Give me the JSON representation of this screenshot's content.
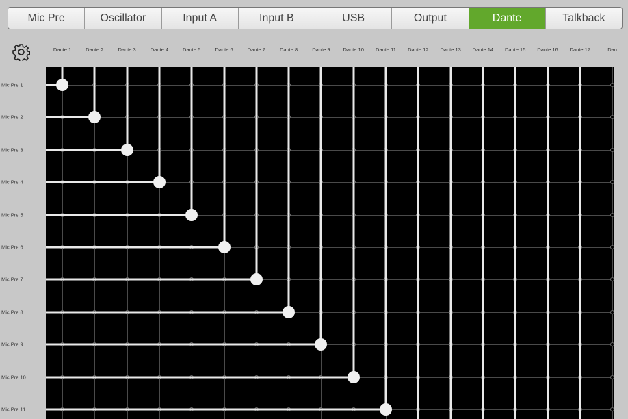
{
  "tabs": [
    {
      "label": "Mic Pre"
    },
    {
      "label": "Oscillator"
    },
    {
      "label": "Input A"
    },
    {
      "label": "Input B"
    },
    {
      "label": "USB"
    },
    {
      "label": "Output"
    },
    {
      "label": "Dante",
      "active": true
    },
    {
      "label": "Talkback"
    }
  ],
  "colors": {
    "active_tab": "#62a82c",
    "grid_bg": "#000000",
    "route": "#e8e8e8",
    "panel_bg": "#c8c8c8"
  },
  "settings_icon": "gear-icon",
  "columns": [
    "Dante 1",
    "Dante 2",
    "Dante 3",
    "Dante 4",
    "Dante 5",
    "Dante 6",
    "Dante 7",
    "Dante 8",
    "Dante 9",
    "Dante 10",
    "Dante 11",
    "Dante 12",
    "Dante 13",
    "Dante 14",
    "Dante 15",
    "Dante 16",
    "Dante 17",
    "Dan"
  ],
  "rows": [
    "Mic Pre 1",
    "Mic Pre 2",
    "Mic Pre 3",
    "Mic Pre 4",
    "Mic Pre 5",
    "Mic Pre 6",
    "Mic Pre 7",
    "Mic Pre 8",
    "Mic Pre 9",
    "Mic Pre 10",
    "Mic Pre 11"
  ],
  "routes": [
    {
      "row": "Mic Pre 1",
      "column": "Dante 1"
    },
    {
      "row": "Mic Pre 2",
      "column": "Dante 2"
    },
    {
      "row": "Mic Pre 3",
      "column": "Dante 3"
    },
    {
      "row": "Mic Pre 4",
      "column": "Dante 4"
    },
    {
      "row": "Mic Pre 5",
      "column": "Dante 5"
    },
    {
      "row": "Mic Pre 6",
      "column": "Dante 6"
    },
    {
      "row": "Mic Pre 7",
      "column": "Dante 7"
    },
    {
      "row": "Mic Pre 8",
      "column": "Dante 8"
    },
    {
      "row": "Mic Pre 9",
      "column": "Dante 9"
    },
    {
      "row": "Mic Pre 10",
      "column": "Dante 10"
    },
    {
      "row": "Mic Pre 11",
      "column": "Dante 11"
    }
  ]
}
